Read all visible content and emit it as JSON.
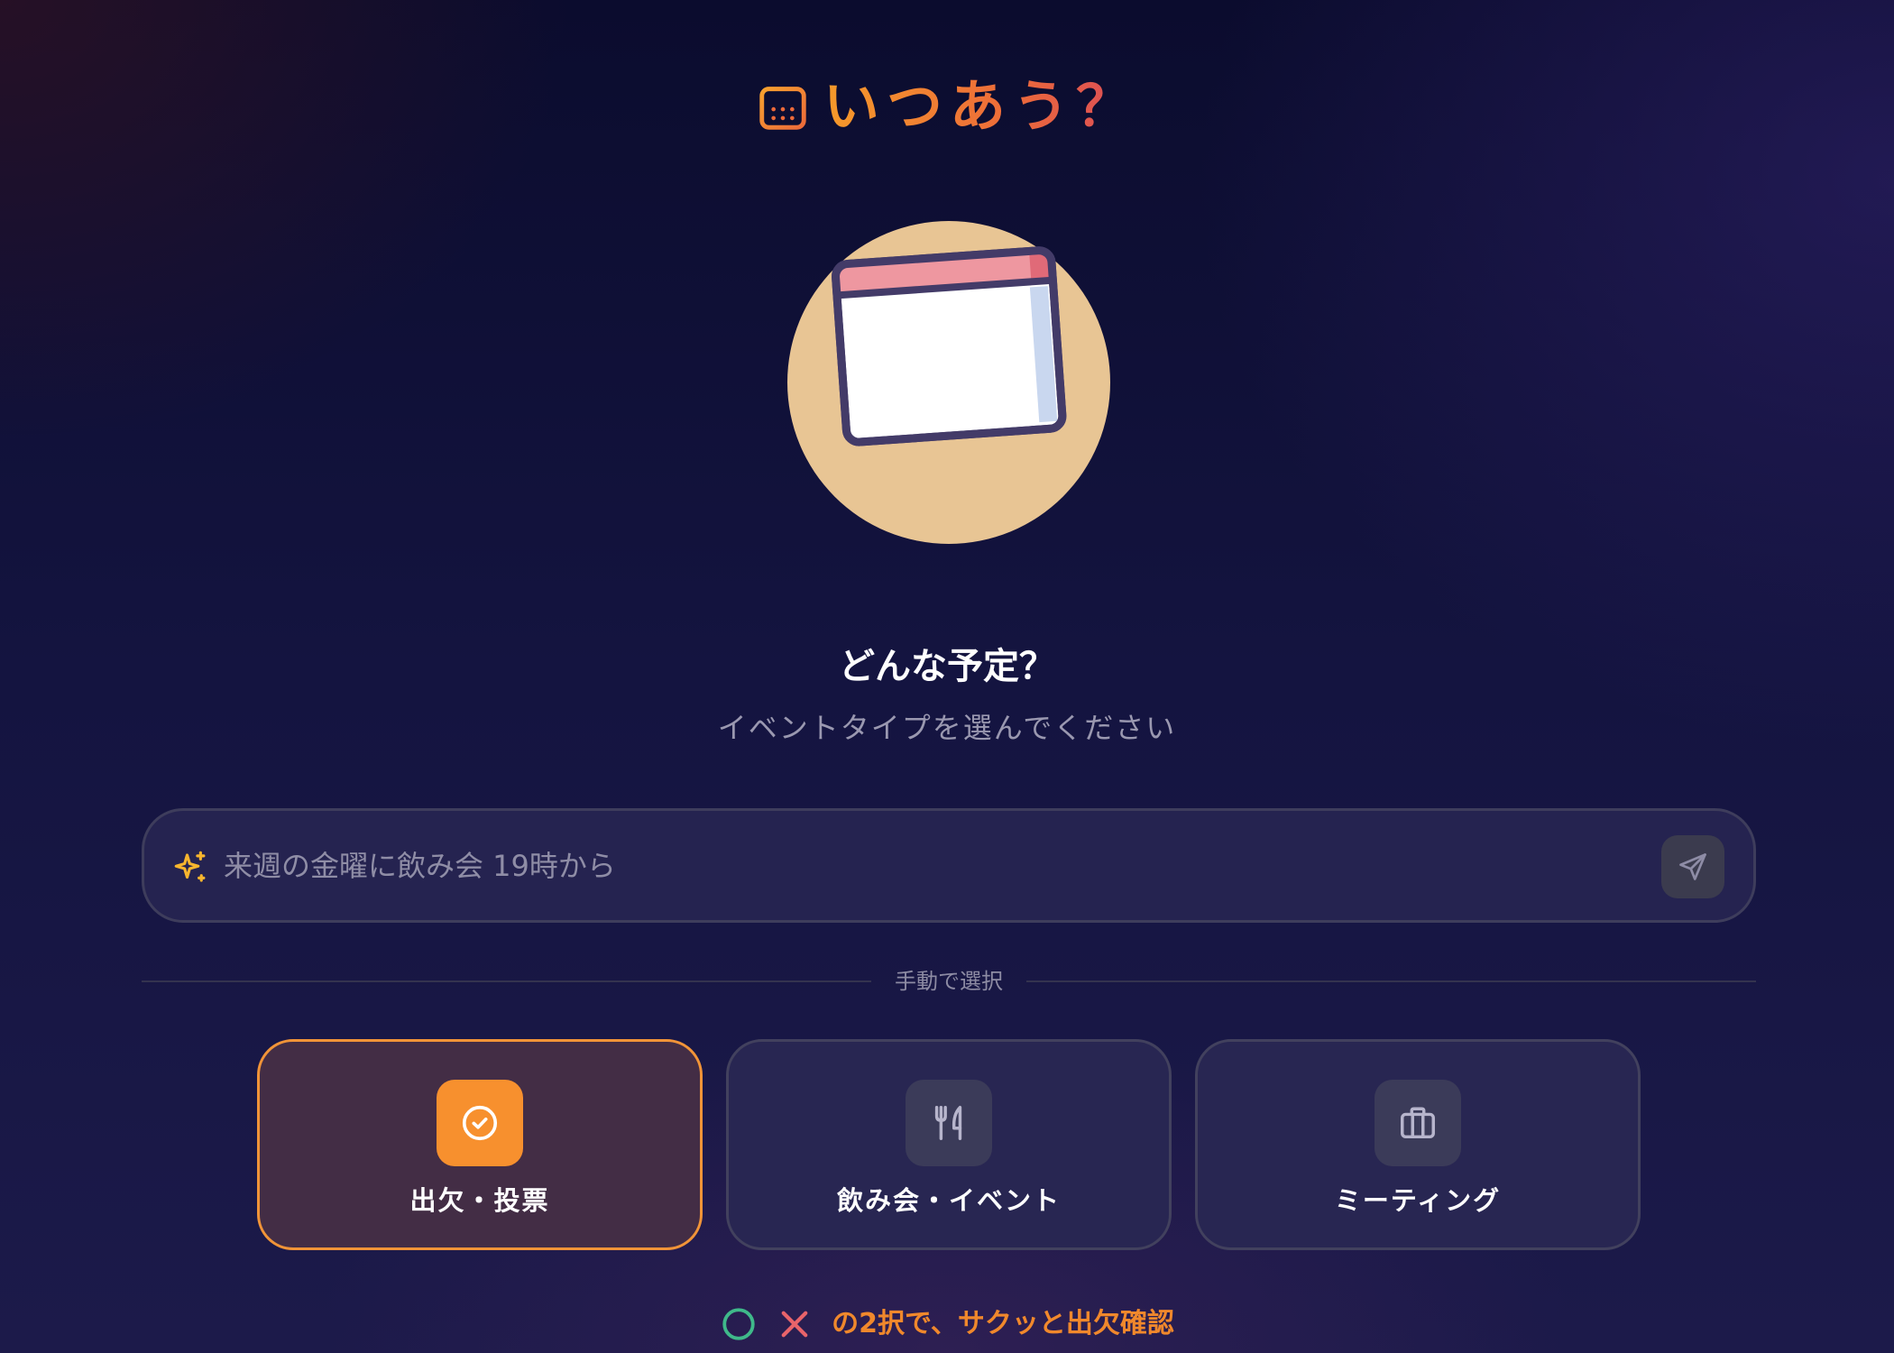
{
  "app": {
    "title": "いつあう？",
    "accent_color": "#f7902e",
    "logo_icon": "calendar-icon"
  },
  "hero": {
    "icon": "calendar-illustration"
  },
  "heading": {
    "title": "どんな予定？",
    "subtitle": "イベントタイプを選んでください"
  },
  "search": {
    "placeholder": "来週の金曜に飲み会 19時から",
    "value": "",
    "icon": "sparkles-icon",
    "send_icon": "send-icon"
  },
  "divider": {
    "label": "手動で選択"
  },
  "event_types": [
    {
      "label": "出欠・投票",
      "icon": "check-circle-icon",
      "selected": true
    },
    {
      "label": "飲み会・イベント",
      "icon": "fork-knife-icon",
      "selected": false
    },
    {
      "label": "ミーティング",
      "icon": "briefcase-icon",
      "selected": false
    }
  ],
  "footer": {
    "text": "の2択で、サクッと出欠確認",
    "symbols": [
      "circle-icon",
      "cross-icon"
    ]
  }
}
